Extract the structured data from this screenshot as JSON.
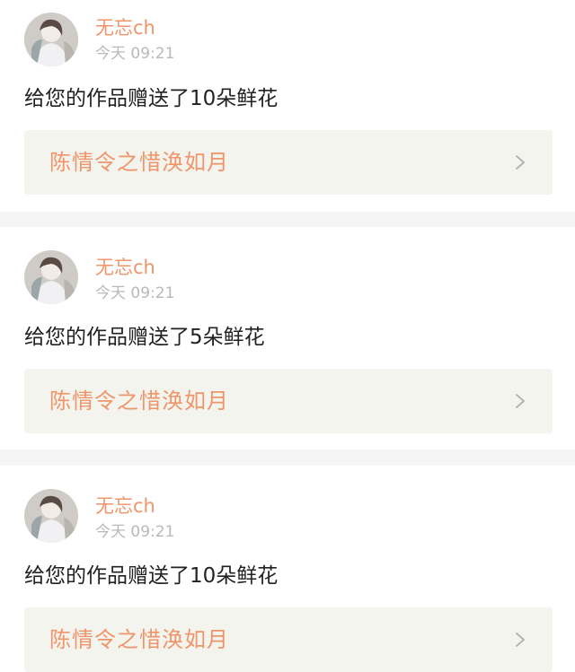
{
  "notifications": [
    {
      "username": "无忘ch",
      "time": "今天 09:21",
      "message": "给您的作品赠送了10朵鲜花",
      "work_title": "陈情令之惜涣如月",
      "chevron_icon": "chevron-right-icon"
    },
    {
      "username": "无忘ch",
      "time": "今天 09:21",
      "message": "给您的作品赠送了5朵鲜花",
      "work_title": "陈情令之惜涣如月",
      "chevron_icon": "chevron-right-icon"
    },
    {
      "username": "无忘ch",
      "time": "今天 09:21",
      "message": "给您的作品赠送了10朵鲜花",
      "work_title": "陈情令之惜涣如月",
      "chevron_icon": "chevron-right-icon"
    }
  ],
  "colors": {
    "accent": "#f0956a",
    "timestamp": "#b9b9b9",
    "text": "#222222",
    "link_bg": "#f4f4ef",
    "separator": "#f5f5f5"
  }
}
